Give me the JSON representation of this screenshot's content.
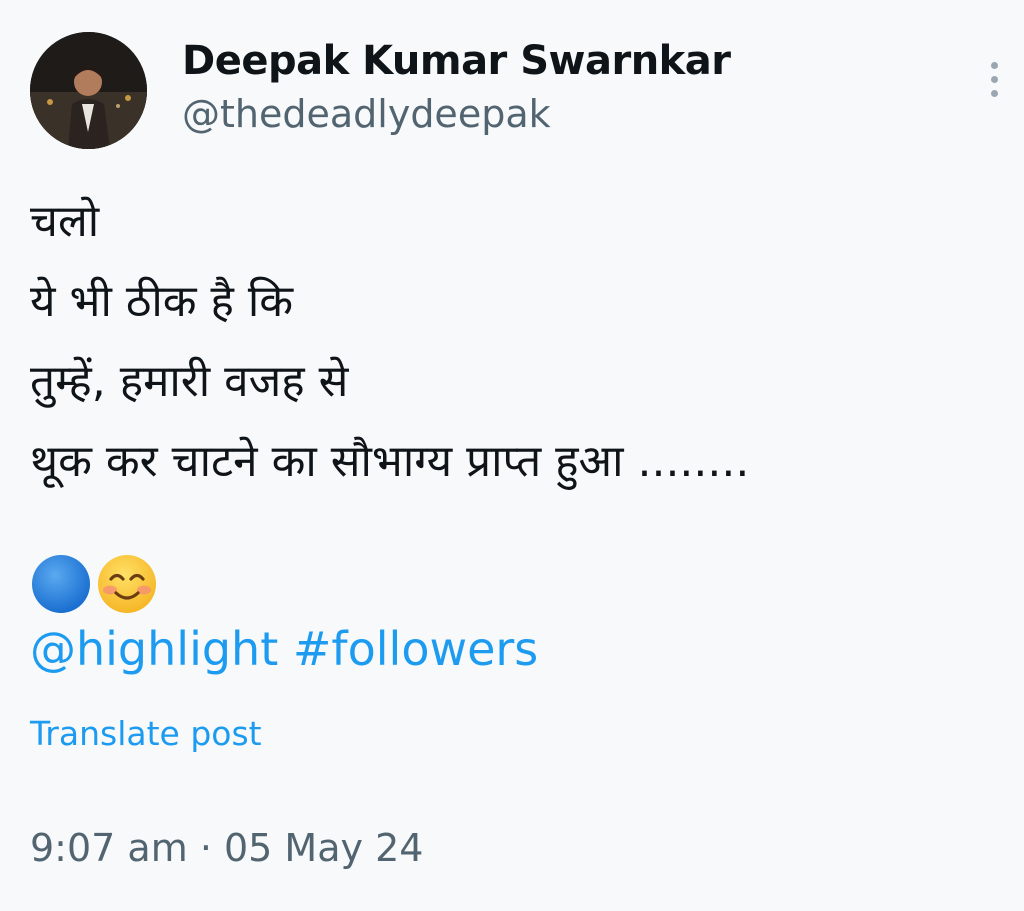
{
  "author": {
    "name": "Deepak Kumar Swarnkar",
    "handle": "@thedeadlydeepak",
    "avatar_icon": "profile-photo"
  },
  "post": {
    "lines": [
      "चलो",
      "ये भी ठीक है कि",
      "तुम्हें, हमारी वजह से",
      "थूक कर चाटने का सौभाग्य प्राप्त हुआ ........"
    ],
    "emojis": [
      "blue-circle-icon",
      "smiling-face-icon"
    ],
    "mention": "@highlight",
    "hashtag": "#followers",
    "translate_label": "Translate post",
    "time": "9:07 am",
    "separator": "·",
    "date": "05 May 24"
  },
  "more_menu_icon": "more-vertical-icon",
  "colors": {
    "link": "#1d9bf0",
    "secondary_text": "#536471",
    "primary_text": "#0f1419",
    "background": "#f7f9fa"
  }
}
